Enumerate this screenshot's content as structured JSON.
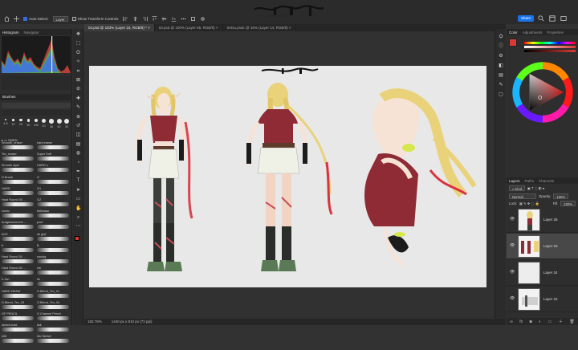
{
  "options_bar": {
    "auto_select_label": "Auto-Select:",
    "auto_select_target": "Layer",
    "show_transform_label": "Show Transform Controls"
  },
  "share_button": "Share",
  "doc_tabs": [
    {
      "label": "04.psd @ 183% (Layer 23, RGB/8) *",
      "active": true
    },
    {
      "label": "03.psd @ 100% (Layer 65, RGB/8)",
      "active": false
    },
    {
      "label": "Setsu.psdc @ 16% (Layer 14, RGB/8)",
      "active": false
    }
  ],
  "left_panel": {
    "tabs": [
      "Histogram",
      "Navigator"
    ],
    "brushes_tab": "Brushes",
    "brush_sizes": [
      "4.5",
      "12",
      "25",
      "50",
      "100",
      "20",
      "36",
      "40",
      "30"
    ],
    "brush_folder": "SMEN",
    "brushes": [
      "Smooth_eraser",
      "hard eraser",
      "Tex_eraser",
      "Super Soft",
      "Smooth style",
      "HARD s",
      "G.Brush",
      "G",
      "HARD",
      "G1",
      "Hard Round 30 ...",
      "G2",
      "comic",
      "bbbbaaa",
      "Aufgenommene ...",
      "pcnt",
      "ACE",
      "dk grid",
      "K",
      "B",
      "Hard Round 30 ...",
      "smudg",
      "Hard Round 30 ...",
      "ink",
      "k-Yan",
      "kk",
      "HARD DRAW",
      "G.Blend_Tex_01",
      "G.Blend_Tex_03",
      "G.Blend_Tex_04",
      "GF PENCIL",
      "G Channel Pencil",
      "sketch-bold",
      "kkk",
      "k08",
      "Ink Sketch"
    ]
  },
  "right_panel": {
    "color_tabs": [
      "Color",
      "Adjustments",
      "Properties"
    ],
    "layers_tabs": [
      "Layers",
      "Paths",
      "Channels"
    ],
    "kind_label": "Kind",
    "blend_mode": "Normal",
    "opacity_label": "Opacity:",
    "opacity_value": "100%",
    "fill_label": "Fill:",
    "fill_value": "100%",
    "lock_label": "Lock:",
    "layers": [
      {
        "name": "Layer 26",
        "selected": false
      },
      {
        "name": "Layer 23",
        "selected": true
      },
      {
        "name": "Layer 24",
        "selected": false
      },
      {
        "name": "Layer 22",
        "selected": false
      }
    ]
  },
  "status": {
    "zoom": "182.78%",
    "doc_size": "1440 px x 810 px (72 ppi)"
  },
  "colors": {
    "accent": "#1a73e8",
    "panel_bg": "#2e2e2e",
    "artboard": "#e8e8e8"
  }
}
